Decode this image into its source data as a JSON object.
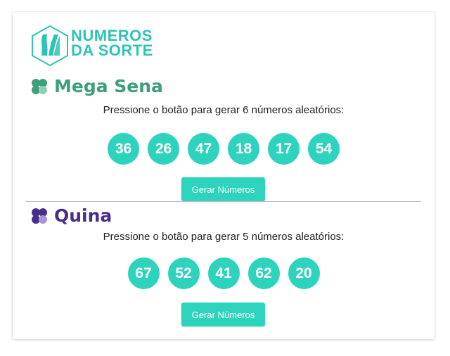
{
  "logo": {
    "line1": "NUMEROS",
    "line2": "DA SORTE",
    "color": "#2ec4b4"
  },
  "mega": {
    "brand": "Mega Sena",
    "brand_color": "#3d9f78",
    "instruction": "Pressione o botão para gerar 6 números aleatórios:",
    "numbers": [
      "36",
      "26",
      "47",
      "18",
      "17",
      "54"
    ],
    "button_label": "Gerar Números"
  },
  "quina": {
    "brand": "Quina",
    "brand_color": "#4a2d8a",
    "instruction": "Pressione o botão para gerar 5 números aleatórios:",
    "numbers": [
      "67",
      "52",
      "41",
      "62",
      "20"
    ],
    "button_label": "Gerar Números"
  },
  "accent_color": "#2ed3bd"
}
